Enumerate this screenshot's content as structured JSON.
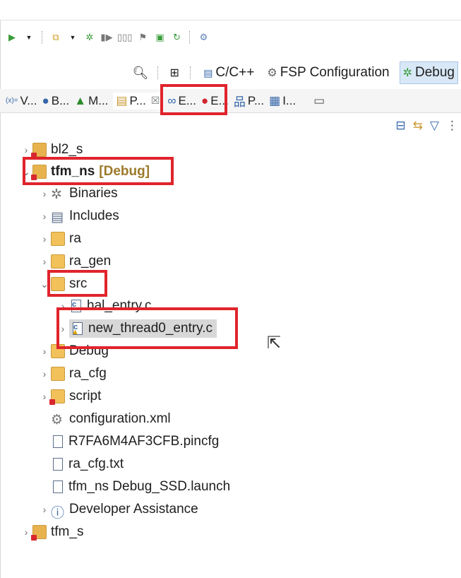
{
  "perspectives": {
    "items": [
      {
        "label": "C/C++"
      },
      {
        "label": "FSP Configuration"
      },
      {
        "label": "Debug"
      }
    ]
  },
  "view_tabs": [
    {
      "label": "V..."
    },
    {
      "label": "B..."
    },
    {
      "label": "M..."
    },
    {
      "label": "P..."
    },
    {
      "label": "E..."
    },
    {
      "label": "E..."
    },
    {
      "label": "P..."
    },
    {
      "label": "I..."
    }
  ],
  "close_glyph": "☒",
  "tree": {
    "bl2_s": "bl2_s",
    "tfm_ns": {
      "name": "tfm_ns",
      "decoration": "[Debug]"
    },
    "binaries": "Binaries",
    "includes": "Includes",
    "ra": "ra",
    "ra_gen": "ra_gen",
    "src": "src",
    "hal_entry": "hal_entry.c",
    "new_thread": "new_thread0_entry.c",
    "debug": "Debug",
    "ra_cfg": "ra_cfg",
    "script": "script",
    "configuration": "configuration.xml",
    "pincfg": "R7FA6M4AF3CFB.pincfg",
    "ra_cfg_txt": "ra_cfg.txt",
    "launch": "tfm_ns Debug_SSD.launch",
    "dev_assist": "Developer Assistance",
    "tfm_s": "tfm_s"
  },
  "colors": {
    "highlight": "#e0242c",
    "active_perspective": "#d9e8f7",
    "decoration": "#9c7a2b"
  }
}
